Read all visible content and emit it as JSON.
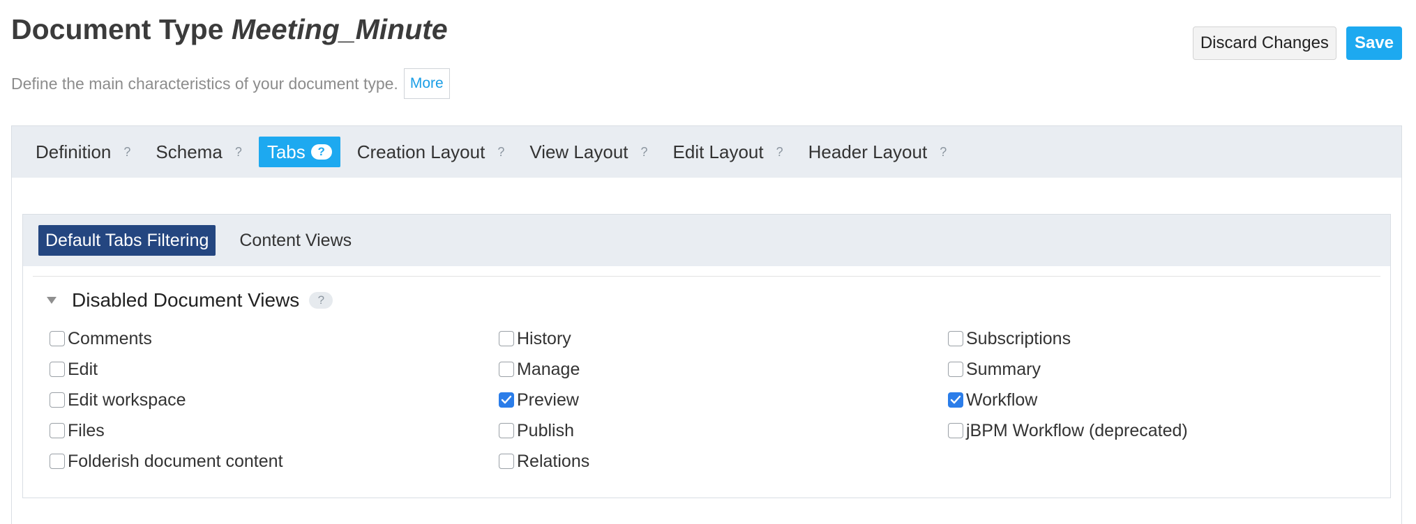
{
  "header": {
    "title_prefix": "Document Type",
    "doc_name": "Meeting_Minute",
    "description": "Define the main characteristics of your document type.",
    "more_label": "More",
    "discard_label": "Discard Changes",
    "save_label": "Save"
  },
  "main_tabs": [
    {
      "label": "Definition",
      "help": "?",
      "active": false
    },
    {
      "label": "Schema",
      "help": "?",
      "active": false
    },
    {
      "label": "Tabs",
      "help": "?",
      "active": true
    },
    {
      "label": "Creation Layout",
      "help": "?",
      "active": false
    },
    {
      "label": "View Layout",
      "help": "?",
      "active": false
    },
    {
      "label": "Edit Layout",
      "help": "?",
      "active": false
    },
    {
      "label": "Header Layout",
      "help": "?",
      "active": false
    }
  ],
  "sub_tabs": [
    {
      "label": "Default Tabs Filtering",
      "active": true
    },
    {
      "label": "Content Views",
      "active": false
    }
  ],
  "section": {
    "title": "Disabled Document Views",
    "help": "?",
    "expanded": true
  },
  "options": [
    {
      "label": "Comments",
      "checked": false
    },
    {
      "label": "History",
      "checked": false
    },
    {
      "label": "Subscriptions",
      "checked": false
    },
    {
      "label": "Edit",
      "checked": false
    },
    {
      "label": "Manage",
      "checked": false
    },
    {
      "label": "Summary",
      "checked": false
    },
    {
      "label": "Edit workspace",
      "checked": false
    },
    {
      "label": "Preview",
      "checked": true
    },
    {
      "label": "Workflow",
      "checked": true
    },
    {
      "label": "Files",
      "checked": false
    },
    {
      "label": "Publish",
      "checked": false
    },
    {
      "label": "jBPM Workflow (deprecated)",
      "checked": false
    },
    {
      "label": "Folderish document content",
      "checked": false
    },
    {
      "label": "Relations",
      "checked": false
    }
  ],
  "colors": {
    "accent": "#1da9f0",
    "subtab_active": "#244680",
    "checkbox_checked": "#2b7de9",
    "tabbar_bg": "#e9edf2"
  },
  "icons": {
    "help": "question-mark-icon",
    "collapse": "triangle-down-icon",
    "check": "checkmark-icon"
  }
}
